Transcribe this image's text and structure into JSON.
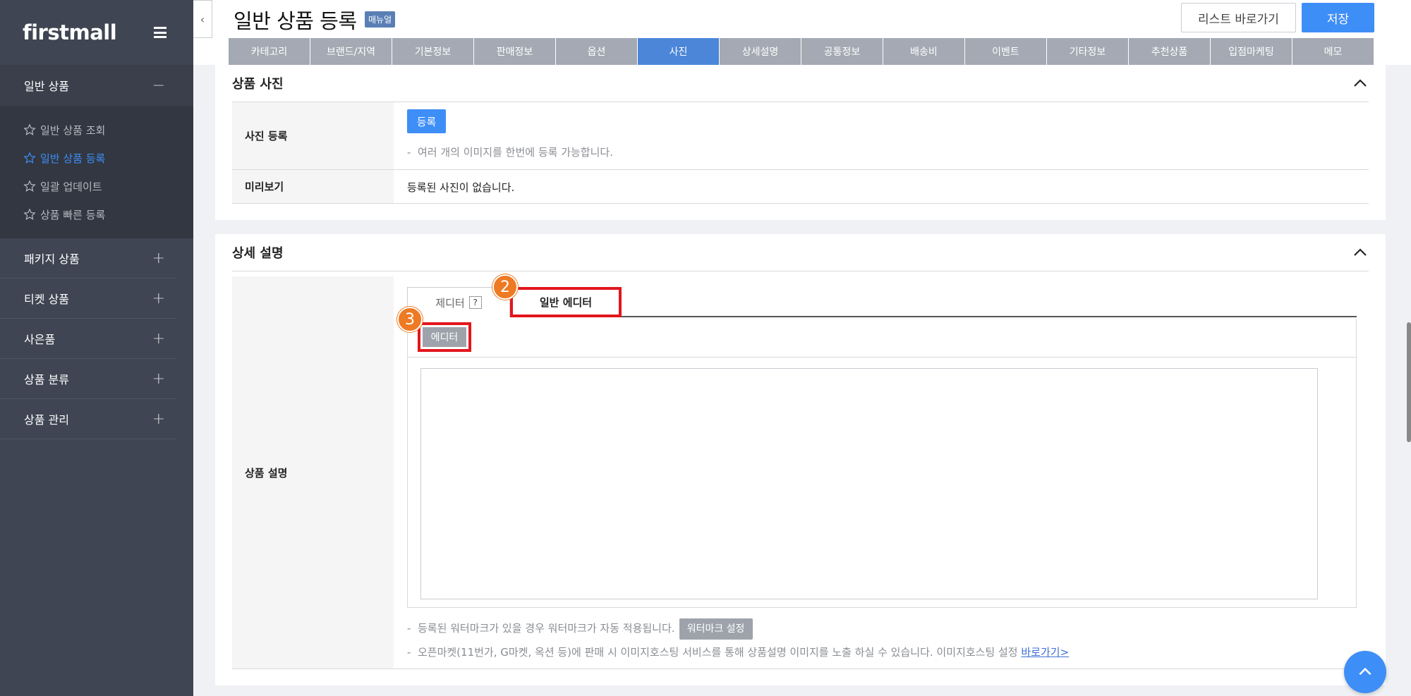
{
  "sidebar": {
    "logo": "firstmall",
    "groups": [
      {
        "label": "일반 상품",
        "sign": "−"
      }
    ],
    "subitems": [
      {
        "label": "일반 상품 조회"
      },
      {
        "label": "일반 상품 등록"
      },
      {
        "label": "일괄 업데이트"
      },
      {
        "label": "상품 빠른 등록"
      }
    ],
    "items": [
      {
        "label": "패키지 상품",
        "sign": "+"
      },
      {
        "label": "티켓 상품",
        "sign": "+"
      },
      {
        "label": "사은품",
        "sign": "+"
      },
      {
        "label": "상품 분류",
        "sign": "+"
      },
      {
        "label": "상품 관리",
        "sign": "+"
      }
    ]
  },
  "header": {
    "title": "일반 상품 등록",
    "manual_badge": "매뉴얼",
    "list_button": "리스트 바로가기",
    "save_button": "저장",
    "collapse_glyph": "‹"
  },
  "tabs": [
    "카테고리",
    "브랜드/지역",
    "기본정보",
    "판매정보",
    "옵션",
    "사진",
    "상세설명",
    "공통정보",
    "배송비",
    "이벤트",
    "기타정보",
    "추천상품",
    "입점마케팅",
    "메모"
  ],
  "photo_section": {
    "title": "상품 사진",
    "register_label": "사진 등록",
    "register_button": "등록",
    "register_note": "여러 개의 이미지를 한번에 등록 가능합니다.",
    "preview_label": "미리보기",
    "preview_value": "등록된 사진이 없습니다."
  },
  "detail_section": {
    "title": "상세 설명",
    "row_label": "상품 설명",
    "tab_zeditor": "제디터",
    "tab_help": "?",
    "tab_general": "일반 에디터",
    "editor_button": "에디터",
    "step2": "2",
    "step3": "3",
    "note1": "등록된 워터마크가 있을 경우 워터마크가 자동 적용됩니다.",
    "watermark_button": "워터마크 설정",
    "note2": "오픈마켓(11번가, G마켓, 옥션 등)에 판매 시 이미지호스팅 서비스를 통해 상품설명 이미지를 노출 하실 수 있습니다. 이미지호스팅 설정",
    "note2_link": "바로가기>",
    "dash": "-"
  },
  "colors": {
    "accent": "#3e8ef7",
    "sidebar_bg": "#3f4552",
    "highlight_red": "#e3161d",
    "step_orange": "#ee7a23"
  }
}
